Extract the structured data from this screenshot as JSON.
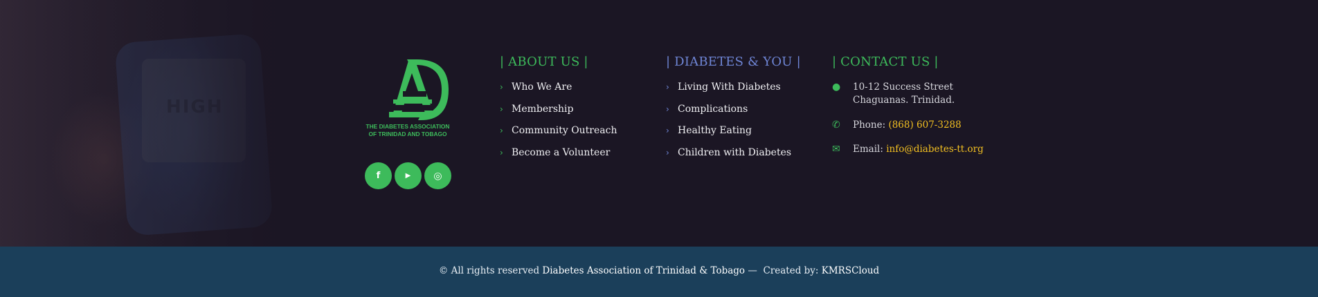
{
  "brand": {
    "logo_text_line1": "THE DIABETES ASSOCIATION",
    "logo_text_line2": "OF TRINIDAD AND TOBAGO",
    "accent_green": "#3dbb5b",
    "accent_blue": "#6f86d6",
    "accent_yellow": "#f3c021"
  },
  "social": [
    {
      "name": "facebook-icon",
      "glyph": "f"
    },
    {
      "name": "youtube-icon",
      "glyph": "▶"
    },
    {
      "name": "instagram-icon",
      "glyph": "◎"
    }
  ],
  "about": {
    "heading": "| ABOUT US |",
    "items": [
      "Who We Are",
      "Membership",
      "Community Outreach",
      "Become a Volunteer"
    ]
  },
  "diabetes": {
    "heading": "| DIABETES & YOU |",
    "items": [
      "Living With Diabetes",
      "Complications",
      "Healthy Eating",
      "Children with Diabetes"
    ]
  },
  "contact": {
    "heading": "| CONTACT US |",
    "address_line1": "10-12 Success Street",
    "address_line2": "Chaguanas. Trinidad.",
    "phone_label": "Phone:",
    "phone_value": "(868) 607-3288",
    "email_label": "Email:",
    "email_value": "info@diabetes-tt.org"
  },
  "footer": {
    "copyright": "© All rights reserved",
    "org_name": "Diabetes Association of Trinidad & Tobago",
    "separator": "—",
    "created_by_label": "Created by:",
    "created_by": "KMRSCloud"
  }
}
